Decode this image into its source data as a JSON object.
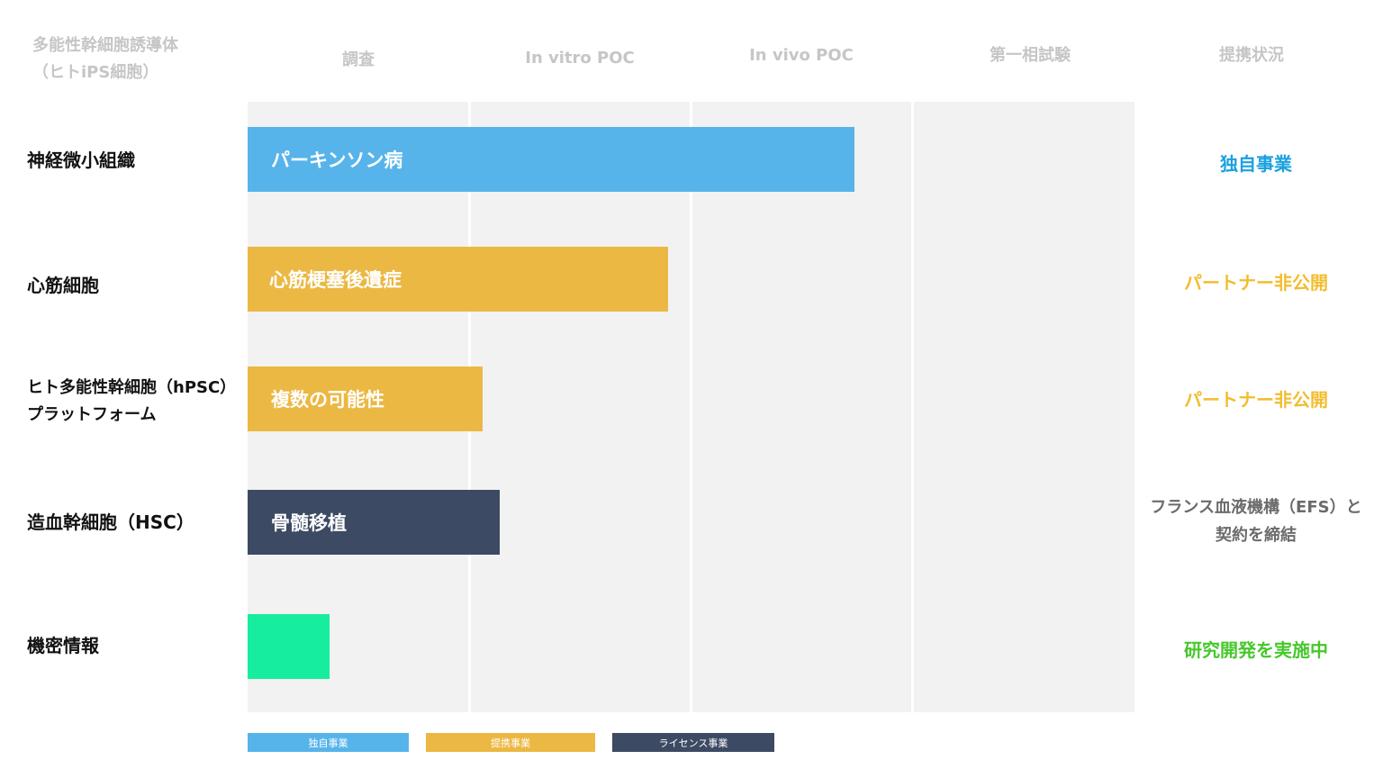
{
  "header": {
    "corner_line1": "多能性幹細胞誘導体",
    "corner_line2": "（ヒトiPS細胞）",
    "stages": [
      "調査",
      "In vitro POC",
      "In vivo POC",
      "第一相試験"
    ],
    "status_title": "提携状況"
  },
  "rows": [
    {
      "label": "神経微小組織",
      "bar_label": "パーキンソン病",
      "status": "独自事業"
    },
    {
      "label": "心筋細胞",
      "bar_label": "心筋梗塞後遺症",
      "status": "パートナー非公開"
    },
    {
      "label_line1": "ヒト多能性幹細胞（hPSC）",
      "label_line2": "プラットフォーム",
      "bar_label": "複数の可能性",
      "status": "パートナー非公開"
    },
    {
      "label": "造血幹細胞（HSC）",
      "bar_label": "骨髄移植",
      "status_line1": "フランス血液機構（EFS）と",
      "status_line2": "契約を締結"
    },
    {
      "label": "機密情報",
      "bar_label": "",
      "status": "研究開発を実施中"
    }
  ],
  "legend": [
    "独自事業",
    "提携事業",
    "ライセンス事業"
  ],
  "colors": {
    "proprietary": "#57b4ea",
    "partnership": "#ebb843",
    "license": "#3c4a63",
    "confidential": "#16ed9f",
    "status_blue": "#1aa1e0",
    "status_yellow": "#f2bd2e",
    "status_green": "#46c82b",
    "status_grey": "#6b6b6b"
  },
  "chart_data": {
    "type": "bar",
    "orientation": "horizontal",
    "stacking": "none",
    "x_axis": {
      "categories": [
        "調査",
        "In vitro POC",
        "In vivo POC",
        "第一相試験"
      ],
      "range": [
        0,
        4
      ],
      "grid": true
    },
    "categories": [
      "神経微小組織",
      "心筋細胞",
      "ヒト多能性幹細胞（hPSC）プラットフォーム",
      "造血幹細胞（HSC）",
      "機密情報"
    ],
    "values": [
      2.74,
      1.9,
      1.06,
      1.14,
      0.37
    ],
    "bar_labels": [
      "パーキンソン病",
      "心筋梗塞後遺症",
      "複数の可能性",
      "骨髄移植",
      ""
    ],
    "bar_types": [
      "独自事業",
      "提携事業",
      "提携事業",
      "ライセンス事業",
      "機密情報"
    ],
    "legend": {
      "entries": [
        "独自事業",
        "提携事業",
        "ライセンス事業"
      ],
      "placement": "bottom"
    }
  }
}
